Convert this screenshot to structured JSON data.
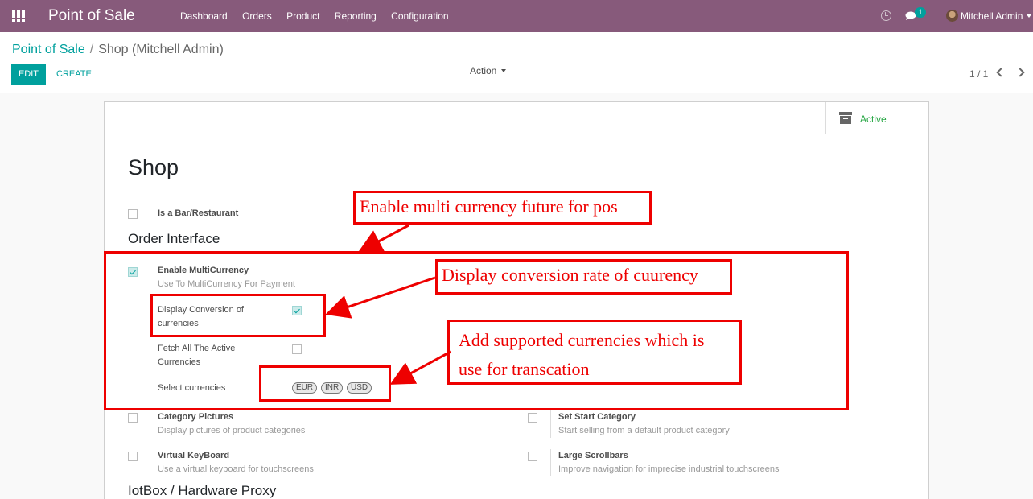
{
  "navbar": {
    "app_title": "Point of Sale",
    "menu": [
      "Dashboard",
      "Orders",
      "Product",
      "Reporting",
      "Configuration"
    ],
    "chat_badge": "1",
    "user_name": "Mitchell Admin"
  },
  "breadcrumb": {
    "root": "Point of Sale",
    "separator": "/",
    "current": "Shop (Mitchell Admin)"
  },
  "buttons": {
    "edit": "EDIT",
    "create": "CREATE",
    "action": "Action"
  },
  "pager": {
    "text": "1 / 1"
  },
  "sheet": {
    "active_label": "Active",
    "title": "Shop",
    "is_bar_label": "Is a Bar/Restaurant",
    "order_interface_title": "Order Interface",
    "multicurrency": {
      "label": "Enable MultiCurrency",
      "help": "Use To MultiCurrency For Payment",
      "display_conversion_label": "Display Conversion of currencies",
      "fetch_active_label": "Fetch All The Active Currencies",
      "select_currencies_label": "Select currencies",
      "currencies": [
        "EUR",
        "INR",
        "USD"
      ]
    },
    "category_pictures": {
      "label": "Category Pictures",
      "help": "Display pictures of product categories"
    },
    "set_start_category": {
      "label": "Set Start Category",
      "help": "Start selling from a default product category"
    },
    "virtual_keyboard": {
      "label": "Virtual KeyBoard",
      "help": "Use a virtual keyboard for touchscreens"
    },
    "large_scrollbars": {
      "label": "Large Scrollbars",
      "help": "Improve navigation for imprecise industrial touchscreens"
    },
    "iotbox_title": "IotBox / Hardware Proxy"
  },
  "annotations": {
    "enable_multi": "Enable multi currency future for pos",
    "display_rate": "Display conversion rate of cuurency",
    "add_currencies": "Add supported currencies which is use for transcation"
  },
  "colors": {
    "navbar": "#875a7b",
    "primary": "#00a09d",
    "annotation": "#ee0000",
    "active": "#28a745"
  }
}
